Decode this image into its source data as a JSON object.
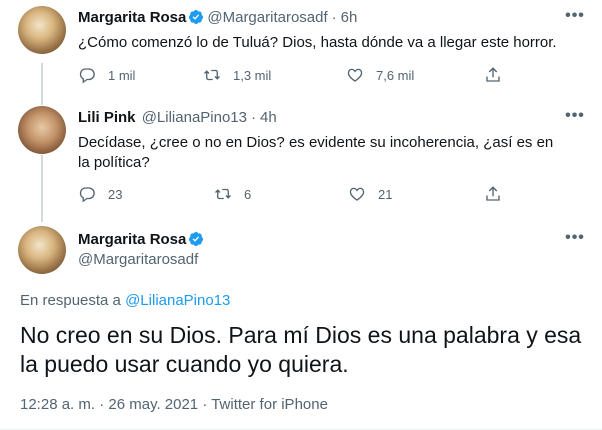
{
  "tweet1": {
    "name": "Margarita Rosa",
    "handle": "@Margaritarosadf",
    "time": "6h",
    "text": "¿Cómo comenzó lo de Tuluá? Dios, hasta dónde va a llegar este horror.",
    "replies": "1 mil",
    "retweets": "1,3 mil",
    "likes": "7,6 mil"
  },
  "tweet2": {
    "name": "Lili Pink",
    "handle": "@LilianaPino13",
    "time": "4h",
    "text": "Decídase, ¿cree o no en Dios? es evidente su incoherencia, ¿así es en la política?",
    "replies": "23",
    "retweets": "6",
    "likes": "21"
  },
  "main": {
    "name": "Margarita Rosa",
    "handle": "@Margaritarosadf",
    "reply_prefix": "En respuesta a",
    "reply_handle": "@LilianaPino13",
    "text": "No creo en su Dios. Para mí Dios es una palabra y esa la puedo usar cuando yo quiera.",
    "timestamp": "12:28 a. m. · 26 may. 2021 · Twitter for iPhone"
  },
  "separator": "·",
  "colors": {
    "accent": "#1d9bf0",
    "muted": "#536471",
    "text": "#0f1419"
  }
}
